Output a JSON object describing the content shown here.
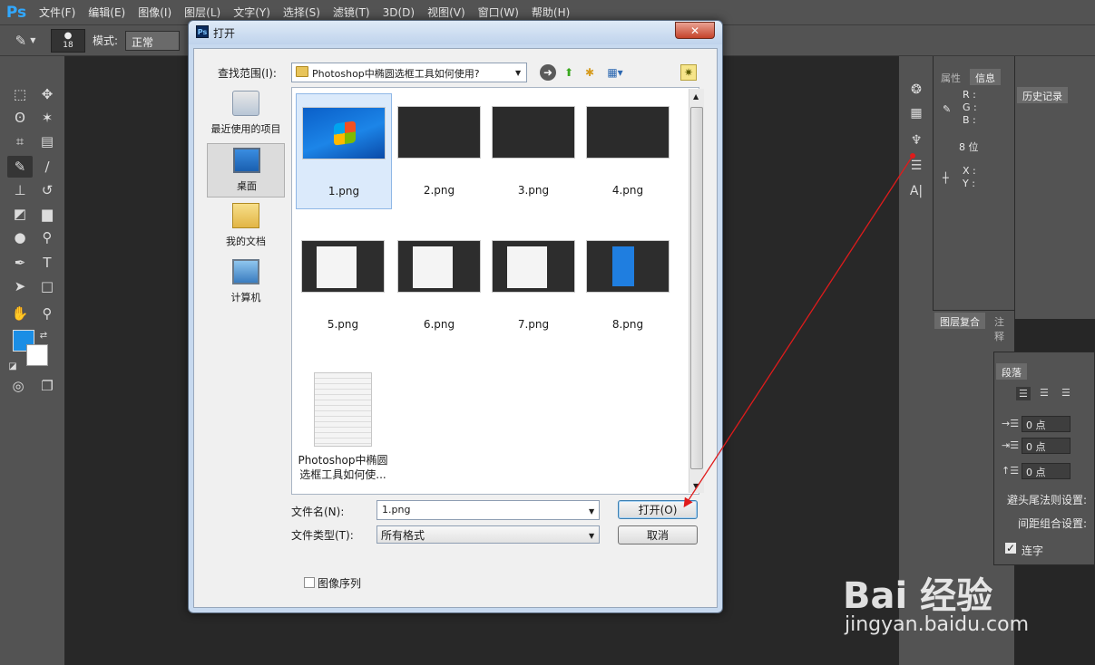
{
  "app": {
    "logo": "Ps",
    "menu": [
      "文件(F)",
      "编辑(E)",
      "图像(I)",
      "图层(L)",
      "文字(Y)",
      "选择(S)",
      "滤镜(T)",
      "3D(D)",
      "视图(V)",
      "窗口(W)",
      "帮助(H)"
    ]
  },
  "options": {
    "brush_size": "18",
    "mode_label": "模式:",
    "mode_value": "正常"
  },
  "colors": {
    "foreground": "#1b8ee5",
    "background": "#ffffff"
  },
  "right_panels": {
    "tab_properties": "属性",
    "tab_info": "信息",
    "info_r": "R :",
    "info_g": "G :",
    "info_b": "B :",
    "info_bits": "8 位",
    "info_x": "X :",
    "info_y": "Y :",
    "history_tab": "历史记录",
    "layer_comps_tab": "图层复合",
    "notes_tab": "注释",
    "paragraph": {
      "tab": "段落",
      "indent_left": "0 点",
      "indent_first": "0 点",
      "space_before": "0 点",
      "kinsoku_label": "避头尾法则设置:",
      "mojikumi_label": "间距组合设置:",
      "hyphenate_label": "连字"
    }
  },
  "dialog": {
    "title": "打开",
    "close": "✕",
    "look_in_label": "查找范围(I):",
    "look_in_value": "Photoshop中椭圆选框工具如何使用?",
    "places": [
      {
        "label": "最近使用的项目"
      },
      {
        "label": "桌面"
      },
      {
        "label": "我的文档"
      },
      {
        "label": "计算机"
      }
    ],
    "files": [
      {
        "name": "1.png"
      },
      {
        "name": "2.png"
      },
      {
        "name": "3.png"
      },
      {
        "name": "4.png"
      },
      {
        "name": "5.png"
      },
      {
        "name": "6.png"
      },
      {
        "name": "7.png"
      },
      {
        "name": "8.png"
      },
      {
        "name_line1": "Photoshop中椭圆",
        "name_line2": "选框工具如何使..."
      }
    ],
    "filename_label": "文件名(N):",
    "filename_value": "1.png",
    "filetype_label": "文件类型(T):",
    "filetype_value": "所有格式",
    "open_button": "打开(O)",
    "cancel_button": "取消",
    "image_sequence_label": "图像序列"
  },
  "watermark": {
    "brand": "Bai 经验",
    "url": "jingyan.baidu.com"
  }
}
